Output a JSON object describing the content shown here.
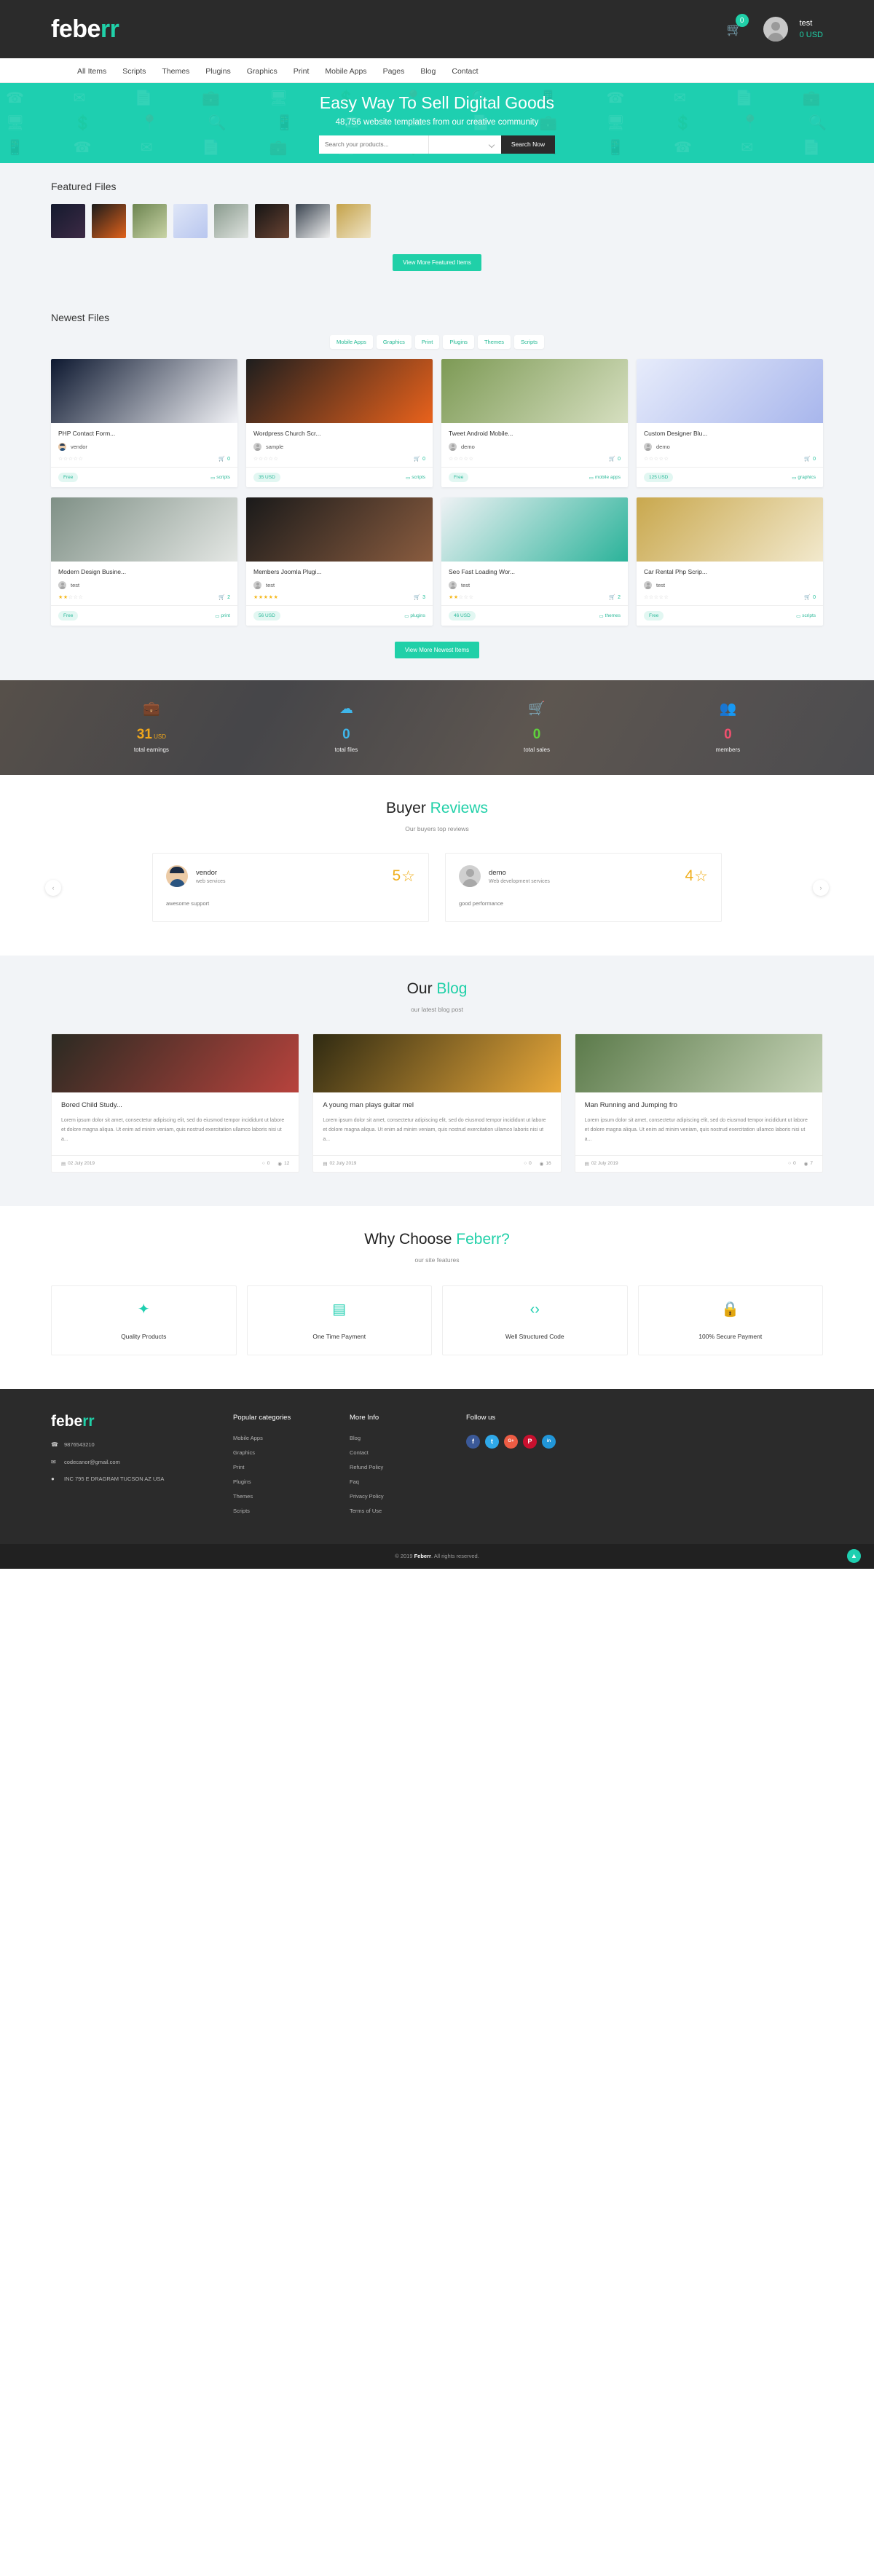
{
  "header": {
    "logo_main": "febe",
    "logo_accent": "rr",
    "cart_count": "0",
    "user_name": "test",
    "user_balance": "0 USD",
    "cart_icon": "shopping-cart-icon",
    "nav": [
      {
        "label": "All Items"
      },
      {
        "label": "Scripts"
      },
      {
        "label": "Themes"
      },
      {
        "label": "Plugins"
      },
      {
        "label": "Graphics"
      },
      {
        "label": "Print"
      },
      {
        "label": "Mobile Apps"
      },
      {
        "label": "Pages"
      },
      {
        "label": "Blog"
      },
      {
        "label": "Contact"
      }
    ]
  },
  "hero": {
    "title": "Easy Way To Sell Digital Goods",
    "subtitle": "48,756 website templates from our creative community",
    "search_placeholder": "Search your products...",
    "search_value": "",
    "category_value": "",
    "search_button": "Search Now"
  },
  "featured": {
    "title": "Featured Files",
    "button": "View More Featured Items",
    "thumbs": [
      {
        "name": "contact-form-thumb",
        "c1": "#141a2e",
        "c2": "#3d2a45"
      },
      {
        "name": "church-theme-thumb",
        "c1": "#1b1b1b",
        "c2": "#e2621b"
      },
      {
        "name": "sweet-life-thumb",
        "c1": "#6c8450",
        "c2": "#c9d4a6"
      },
      {
        "name": "open-content-thumb",
        "c1": "#dfe6f7",
        "c2": "#b8c6ef"
      },
      {
        "name": "leaf-card-thumb",
        "c1": "#8a9b8e",
        "c2": "#dfe3df"
      },
      {
        "name": "portfolio-dark-thumb",
        "c1": "#141414",
        "c2": "#6b4433"
      },
      {
        "name": "marketing-thumb",
        "c1": "#3a4450",
        "c2": "#f0f0f0"
      },
      {
        "name": "car-rental-thumb",
        "c1": "#c4a24a",
        "c2": "#efe4c6"
      }
    ]
  },
  "newest": {
    "title": "Newest Files",
    "button": "View More Newest Items",
    "tabs": [
      {
        "label": "Mobile Apps"
      },
      {
        "label": "Graphics"
      },
      {
        "label": "Print"
      },
      {
        "label": "Plugins"
      },
      {
        "label": "Themes"
      },
      {
        "label": "Scripts"
      }
    ],
    "items": [
      {
        "title": "PHP Contact Form...",
        "author": "vendor",
        "author_avatar": "photo",
        "rating": 0,
        "downloads": "0",
        "price": "Free",
        "category": "scripts",
        "thumb_c1": "#0d1830",
        "thumb_c2": "#f2f3f7"
      },
      {
        "title": "Wordpress Church Scr...",
        "author": "sample",
        "author_avatar": "generic",
        "rating": 0,
        "downloads": "0",
        "price": "35 USD",
        "category": "scripts",
        "thumb_c1": "#1e1e1e",
        "thumb_c2": "#e9621c"
      },
      {
        "title": "Tweet Android Mobile...",
        "author": "demo",
        "author_avatar": "generic",
        "rating": 0,
        "downloads": "0",
        "price": "Free",
        "category": "mobile apps",
        "thumb_c1": "#7d9a55",
        "thumb_c2": "#d6dfc0"
      },
      {
        "title": "Custom Designer Blu...",
        "author": "demo",
        "author_avatar": "generic",
        "rating": 0,
        "downloads": "0",
        "price": "125 USD",
        "category": "graphics",
        "thumb_c1": "#e7ecfb",
        "thumb_c2": "#a8b6ec"
      },
      {
        "title": "Modern Design Busine...",
        "author": "test",
        "author_avatar": "generic",
        "rating": 2,
        "downloads": "2",
        "price": "Free",
        "category": "print",
        "thumb_c1": "#7f9086",
        "thumb_c2": "#e4e7e4"
      },
      {
        "title": "Members Joomla Plugi...",
        "author": "test",
        "author_avatar": "generic",
        "rating": 5,
        "downloads": "3",
        "price": "56 USD",
        "category": "plugins",
        "thumb_c1": "#1a1a1a",
        "thumb_c2": "#8a5c3f"
      },
      {
        "title": "Seo Fast Loading Wor...",
        "author": "test",
        "author_avatar": "generic",
        "rating": 2,
        "downloads": "2",
        "price": "46 USD",
        "category": "themes",
        "thumb_c1": "#eef1f4",
        "thumb_c2": "#2bb39a"
      },
      {
        "title": "Car Rental Php Scrip...",
        "author": "test",
        "author_avatar": "generic",
        "rating": 0,
        "downloads": "0",
        "price": "Free",
        "category": "scripts",
        "thumb_c1": "#c9a84e",
        "thumb_c2": "#f2e9cd"
      }
    ]
  },
  "stats": [
    {
      "icon": "briefcase-icon",
      "glyph": "💼",
      "value": "31",
      "unit": "USD",
      "label": "total earnings",
      "color": "#f0a71c"
    },
    {
      "icon": "cloud-download-icon",
      "glyph": "☁",
      "value": "0",
      "unit": "",
      "label": "total files",
      "color": "#3fb6ea"
    },
    {
      "icon": "shopping-cart-icon",
      "glyph": "🛒",
      "value": "0",
      "unit": "",
      "label": "total sales",
      "color": "#5fd13c"
    },
    {
      "icon": "users-icon",
      "glyph": "👥",
      "value": "0",
      "unit": "",
      "label": "members",
      "color": "#f0506e"
    }
  ],
  "reviews": {
    "title_main": "Buyer ",
    "title_accent": "Reviews",
    "subtitle": "Our buyers top reviews",
    "prev_icon": "chevron-left-icon",
    "next_icon": "chevron-right-icon",
    "items": [
      {
        "name": "vendor",
        "role": "web services",
        "score": "5",
        "text": "awesome support",
        "avatar": "photo"
      },
      {
        "name": "demo",
        "role": "Web development services",
        "score": "4",
        "text": "good performance",
        "avatar": "generic"
      }
    ]
  },
  "blog": {
    "title_main": "Our ",
    "title_accent": "Blog",
    "subtitle": "our latest blog post",
    "posts": [
      {
        "title": "Bored Child Study...",
        "excerpt": "Lorem ipsum dolor sit amet, consectetur adipiscing elit, sed do eiusmod tempor incididunt ut labore et dolore magna aliqua. Ut enim ad minim veniam, quis nostrud exercitation ullamco laboris nisi ut a...",
        "date": "02 July 2019",
        "comments": "0",
        "views": "12",
        "img_c1": "#2a2a22",
        "img_c2": "#b8433d"
      },
      {
        "title": "A young man plays guitar mel",
        "excerpt": "Lorem ipsum dolor sit amet, consectetur adipiscing elit, sed do eiusmod tempor incididunt ut labore et dolore magna aliqua. Ut enim ad minim veniam, quis nostrud exercitation ullamco laboris nisi ut a...",
        "date": "02 July 2019",
        "comments": "0",
        "views": "16",
        "img_c1": "#2f2a12",
        "img_c2": "#e8a83a"
      },
      {
        "title": "Man Running and Jumping fro",
        "excerpt": "Lorem ipsum dolor sit amet, consectetur adipiscing elit, sed do eiusmod tempor incididunt ut labore et dolore magna aliqua. Ut enim ad minim veniam, quis nostrud exercitation ullamco laboris nisi ut a...",
        "date": "02 July 2019",
        "comments": "0",
        "views": "7",
        "img_c1": "#5b7a4a",
        "img_c2": "#c7d4b8"
      }
    ],
    "date_icon": "calendar-icon",
    "comment_icon": "comment-icon",
    "view_icon": "eye-icon"
  },
  "features": {
    "title_main": "Why Choose ",
    "title_accent": "Feberr?",
    "subtitle": "our site features",
    "items": [
      {
        "icon": "magic-wand-icon",
        "glyph": "✦",
        "label": "Quality Products"
      },
      {
        "icon": "banknote-icon",
        "glyph": "▤",
        "label": "One Time Payment"
      },
      {
        "icon": "code-icon",
        "glyph": "‹›",
        "label": "Well Structured Code"
      },
      {
        "icon": "lock-icon",
        "glyph": "🔒",
        "label": "100% Secure Payment"
      }
    ]
  },
  "footer": {
    "logo_main": "febe",
    "logo_accent": "rr",
    "phone": "9876543210",
    "email": "codecanor@gmail.com",
    "address": "INC 795 E DRAGRAM TUCSON AZ USA",
    "phone_icon": "phone-icon",
    "email_icon": "envelope-icon",
    "address_icon": "map-pin-icon",
    "categories_head": "Popular categories",
    "categories": [
      {
        "label": "Mobile Apps"
      },
      {
        "label": "Graphics"
      },
      {
        "label": "Print"
      },
      {
        "label": "Plugins"
      },
      {
        "label": "Themes"
      },
      {
        "label": "Scripts"
      }
    ],
    "moreinfo_head": "More Info",
    "moreinfo": [
      {
        "label": "Blog"
      },
      {
        "label": "Contact"
      },
      {
        "label": "Refund Policy"
      },
      {
        "label": "Faq"
      },
      {
        "label": "Privacy Policy"
      },
      {
        "label": "Terms of Use"
      }
    ],
    "follow_head": "Follow us",
    "socials": [
      {
        "icon": "facebook-icon",
        "glyph": "f",
        "color": "#3b5998"
      },
      {
        "icon": "twitter-icon",
        "glyph": "t",
        "color": "#2fa8e8"
      },
      {
        "icon": "google-plus-icon",
        "glyph": "G+",
        "color": "#ec5c44"
      },
      {
        "icon": "pinterest-icon",
        "glyph": "P",
        "color": "#c8102e"
      },
      {
        "icon": "linkedin-icon",
        "glyph": "in",
        "color": "#2196d8"
      }
    ]
  },
  "copyright": {
    "prefix": "© 2019 ",
    "brand": "Feberr",
    "suffix": ". All rights reserved.",
    "totop_icon": "chevron-up-icon"
  }
}
